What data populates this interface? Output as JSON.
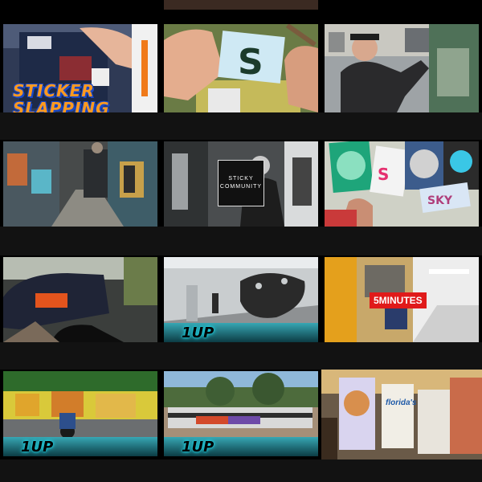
{
  "grid": {
    "columns": 3,
    "tiles": [
      {
        "id": "t1",
        "icon": "sticker-slapping-thumb",
        "overlay_text": "STICKER\nSLAPPING"
      },
      {
        "id": "t2",
        "icon": "hands-sticker-thumb"
      },
      {
        "id": "t3",
        "icon": "man-street-pole-thumb"
      },
      {
        "id": "t4",
        "icon": "graffiti-alley-thumb"
      },
      {
        "id": "t5",
        "icon": "sticky-community-thumb",
        "overlay_text": "STICKY\nCOMMUNITY"
      },
      {
        "id": "t6",
        "icon": "sticker-collage-thumb"
      },
      {
        "id": "t7",
        "icon": "car-night-thumb"
      },
      {
        "id": "t8",
        "icon": "tunnel-graffiti-thumb",
        "badge": "1UP"
      },
      {
        "id": "t9",
        "icon": "subway-train-thumb",
        "overlay_text": "5MINUTES"
      },
      {
        "id": "t10",
        "icon": "graffiti-wall-scooter-thumb",
        "badge": "1UP"
      },
      {
        "id": "t11",
        "icon": "painted-train-thumb",
        "badge": "1UP"
      },
      {
        "id": "t12",
        "icon": "juice-cartons-thumb"
      }
    ]
  },
  "colors": {
    "background": "#000000",
    "caption_strip": "#121212",
    "badge_glow": "#1fd6e6",
    "five_minutes_red": "#e01a1a",
    "sticker_orange": "#ff9a1f",
    "sticker_blue": "#1848c8"
  }
}
